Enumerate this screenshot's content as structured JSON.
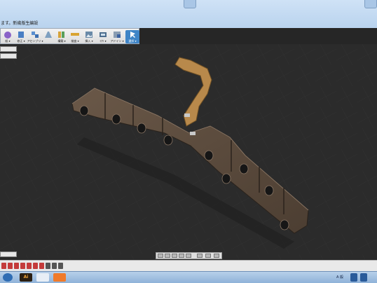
{
  "window": {
    "title": "ます。新幾版生編設"
  },
  "ribbon": {
    "tools": [
      {
        "label": "紙 ▾",
        "icon": "sketch-icon"
      },
      {
        "label": "修正 ▾",
        "icon": "modify-icon"
      },
      {
        "label": "アセンブリ ▾",
        "icon": "assembly-icon"
      },
      {
        "label": "",
        "icon": "joint-icon"
      },
      {
        "label": "構築 ▾",
        "icon": "construct-icon"
      },
      {
        "label": "検査 ▾",
        "icon": "inspect-icon"
      },
      {
        "label": "挿入 ▾",
        "icon": "insert-icon"
      },
      {
        "label": "ｲｸﾘ ▾",
        "icon": "make-icon"
      },
      {
        "label": "アドイン ▾",
        "icon": "addins-icon"
      },
      {
        "label": "選択 ▾",
        "icon": "select-icon"
      }
    ]
  },
  "model": {
    "name": "coat-hanger-model"
  },
  "taskbar": {
    "tray_text": "A 般"
  },
  "colors": {
    "wood": "#5a4a3c",
    "hook": "#b6894a",
    "grid": "#3a3a3a",
    "active_tool": "#3f85c7"
  }
}
